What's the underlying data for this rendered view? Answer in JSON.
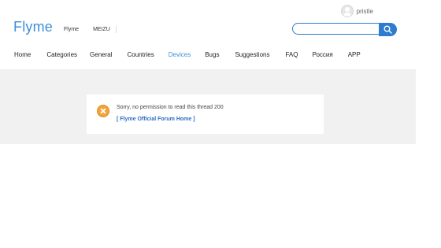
{
  "header": {
    "username": "pristle",
    "logo_text": "Flyme",
    "top_links": [
      "Flyme",
      "MEIZU"
    ],
    "search": {
      "value": "",
      "placeholder": ""
    }
  },
  "nav": {
    "items": [
      {
        "label": "Home"
      },
      {
        "label": "Categories"
      },
      {
        "label": "General"
      },
      {
        "label": "Countries"
      },
      {
        "label": "Devices"
      },
      {
        "label": "Bugs"
      },
      {
        "label": "Suggestions"
      },
      {
        "label": "FAQ"
      },
      {
        "label": "Россия"
      },
      {
        "label": "APP"
      }
    ],
    "active_label": "Devices"
  },
  "message": {
    "text": "Sorry, no permission to read this thread 200",
    "link_text": "[ Flyme Official Forum Home ]"
  },
  "colors": {
    "brand": "#3d8ed8",
    "search_button": "#2e7bd0",
    "band_background": "#f1f1f1",
    "warning": "#f2a33a"
  },
  "icons": {
    "avatar": "user-avatar-icon",
    "search": "search-icon",
    "error": "error-x-icon"
  }
}
